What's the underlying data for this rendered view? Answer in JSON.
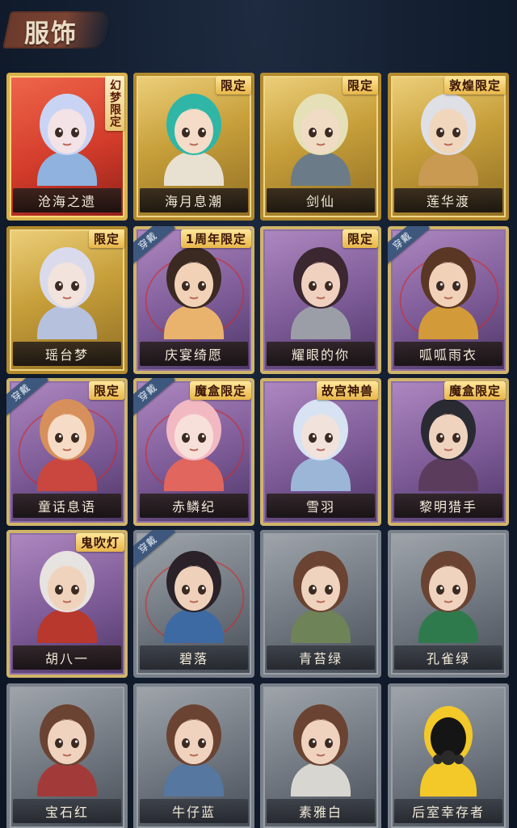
{
  "header": {
    "title": "服饰"
  },
  "worn_label": "穿戴",
  "skins": [
    {
      "name": "沧海之遗",
      "tier": "red",
      "badge": "幻梦限定",
      "badge_style": "vertical",
      "worn": false,
      "hair": "#c9d4f5",
      "skin": "#f4e3e6",
      "cloth": "#8fb2de"
    },
    {
      "name": "海月息潮",
      "tier": "gold",
      "badge": "限定",
      "badge_style": "flat",
      "worn": false,
      "hair": "#2fb6a6",
      "skin": "#f4dcc8",
      "cloth": "#e8e1d2"
    },
    {
      "name": "剑仙",
      "tier": "gold",
      "badge": "限定",
      "badge_style": "flat",
      "worn": false,
      "hair": "#e5e0b8",
      "skin": "#f0dcc4",
      "cloth": "#6c7b88"
    },
    {
      "name": "莲华渡",
      "tier": "gold",
      "badge": "敦煌限定",
      "badge_style": "flat",
      "worn": false,
      "hair": "#dfdfe6",
      "skin": "#f0d6bc",
      "cloth": "#c99a52"
    },
    {
      "name": "瑶台梦",
      "tier": "gold",
      "badge": "限定",
      "badge_style": "flat",
      "worn": false,
      "hair": "#d9dbec",
      "skin": "#f2e3dc",
      "cloth": "#b6c1de"
    },
    {
      "name": "庆宴绮愿",
      "tier": "purple",
      "badge": "1周年限定",
      "badge_style": "flat",
      "worn": true,
      "hair": "#3a2a22",
      "skin": "#f1d2b6",
      "cloth": "#e9b36e"
    },
    {
      "name": "耀眼的你",
      "tier": "purple",
      "badge": "限定",
      "badge_style": "flat",
      "worn": false,
      "hair": "#3a2730",
      "skin": "#f0d0bf",
      "cloth": "#9b9ea6"
    },
    {
      "name": "呱呱雨衣",
      "tier": "purple",
      "badge": "",
      "badge_style": "flat",
      "worn": true,
      "hair": "#5a3624",
      "skin": "#f1d1b8",
      "cloth": "#d39a3a"
    },
    {
      "name": "童话息语",
      "tier": "purple",
      "badge": "限定",
      "badge_style": "flat",
      "worn": true,
      "hair": "#d7905b",
      "skin": "#f6dcc6",
      "cloth": "#c9473f"
    },
    {
      "name": "赤鳞纪",
      "tier": "purple",
      "badge": "魔盒限定",
      "badge_style": "flat",
      "worn": true,
      "hair": "#f2b9c3",
      "skin": "#f8e0da",
      "cloth": "#e0665e"
    },
    {
      "name": "雪羽",
      "tier": "purple",
      "badge": "故宫神兽",
      "badge_style": "flat",
      "worn": false,
      "hair": "#d7e3f2",
      "skin": "#f1e2dc",
      "cloth": "#9cb6d8"
    },
    {
      "name": "黎明猎手",
      "tier": "purple",
      "badge": "魔盒限定",
      "badge_style": "flat",
      "worn": false,
      "hair": "#2a2a33",
      "skin": "#f0d3bf",
      "cloth": "#5b3c5c"
    },
    {
      "name": "胡八一",
      "tier": "purple",
      "badge": "鬼吹灯",
      "badge_style": "flat",
      "worn": false,
      "hair": "#e7e3e0",
      "skin": "#f0d3bc",
      "cloth": "#b8382d"
    },
    {
      "name": "碧落",
      "tier": "gray",
      "badge": "",
      "badge_style": "flat",
      "worn": true,
      "hair": "#2a2228",
      "skin": "#efd1bb",
      "cloth": "#3d6aa3"
    },
    {
      "name": "青苔绿",
      "tier": "gray",
      "badge": "",
      "badge_style": "flat",
      "worn": false,
      "hair": "#6a4332",
      "skin": "#f0d3bf",
      "cloth": "#6f8359"
    },
    {
      "name": "孔雀绿",
      "tier": "gray",
      "badge": "",
      "badge_style": "flat",
      "worn": false,
      "hair": "#6a4332",
      "skin": "#f0d3bf",
      "cloth": "#2f7a4c"
    },
    {
      "name": "宝石红",
      "tier": "gray",
      "badge": "",
      "badge_style": "flat",
      "worn": false,
      "hair": "#6a4332",
      "skin": "#f0d3bf",
      "cloth": "#a33a3a"
    },
    {
      "name": "牛仔蓝",
      "tier": "gray",
      "badge": "",
      "badge_style": "flat",
      "worn": false,
      "hair": "#6a4332",
      "skin": "#f0d3bf",
      "cloth": "#5577a0"
    },
    {
      "name": "素雅白",
      "tier": "gray",
      "badge": "",
      "badge_style": "flat",
      "worn": false,
      "hair": "#6a4332",
      "skin": "#f0d3bf",
      "cloth": "#d8d6d0"
    },
    {
      "name": "后室幸存者",
      "tier": "gray",
      "badge": "",
      "badge_style": "flat",
      "worn": false,
      "hair": "#111111",
      "skin": "#222222",
      "cloth": "#f2c928"
    }
  ]
}
